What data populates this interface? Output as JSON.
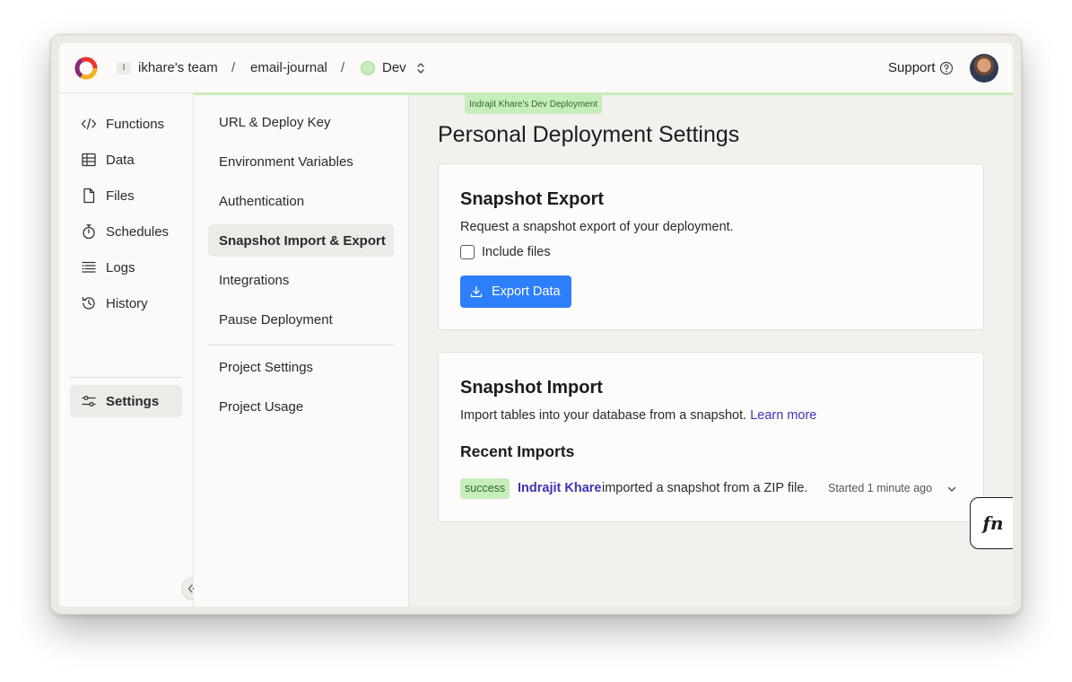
{
  "header": {
    "team_initial": "I",
    "team": "ikhare's team",
    "separator": "/",
    "project": "email-journal",
    "deployment": "Dev",
    "support": "Support"
  },
  "sidebar": {
    "items": [
      {
        "label": "Functions",
        "icon": "code-icon"
      },
      {
        "label": "Data",
        "icon": "table-icon"
      },
      {
        "label": "Files",
        "icon": "file-icon"
      },
      {
        "label": "Schedules",
        "icon": "stopwatch-icon"
      },
      {
        "label": "Logs",
        "icon": "list-icon"
      },
      {
        "label": "History",
        "icon": "history-icon"
      },
      {
        "label": "Settings",
        "icon": "sliders-icon",
        "active": true
      }
    ]
  },
  "settings_menu": {
    "items": [
      "URL & Deploy Key",
      "Environment Variables",
      "Authentication",
      "Snapshot Import & Export",
      "Integrations",
      "Pause Deployment"
    ],
    "project_items": [
      "Project Settings",
      "Project Usage"
    ],
    "active": "Snapshot Import & Export"
  },
  "main": {
    "deployment_tag": "Indrajit Khare's Dev Deployment",
    "title": "Personal Deployment Settings",
    "export": {
      "title": "Snapshot Export",
      "description": "Request a snapshot export of your deployment.",
      "include_files_label": "Include files",
      "include_files_checked": false,
      "button_label": "Export Data"
    },
    "import": {
      "title": "Snapshot Import",
      "description": "Import tables into your database from a snapshot.",
      "learn_more": "Learn more",
      "recent_title": "Recent Imports",
      "recent": [
        {
          "status": "success",
          "user": "Indrajit Khare",
          "text": "imported a snapshot from a ZIP file.",
          "time": "Started 1 minute ago"
        }
      ]
    }
  },
  "fn_button": "fn",
  "colors": {
    "accent": "#2d7ff9",
    "deployment_green": "#c8ecbc",
    "link": "#3d35b8"
  }
}
